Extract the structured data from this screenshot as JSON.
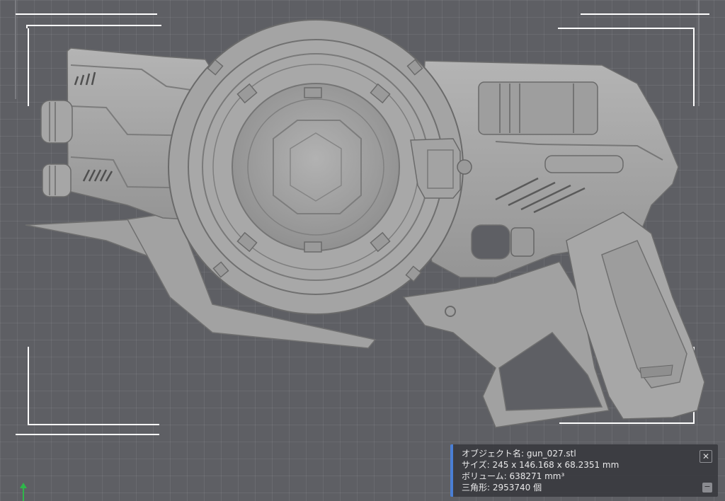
{
  "viewport": {
    "background_color": "#5e5f64",
    "grid_color": "#6a6b70",
    "model_color": "#a8a8a8",
    "frame_color": "#ffffff",
    "axis_color": "#2fb74a"
  },
  "info_panel": {
    "accent_color": "#4a7fd6",
    "object_name": "オブジェクト名: gun_027.stl",
    "size": "サイズ: 245 x 146.168 x 68.2351 mm",
    "volume": "ボリューム: 638271 mm³",
    "triangles": "三角形: 2953740 個",
    "close_icon": "close-icon",
    "close_glyph": "✕",
    "minimize_icon": "minimize-icon",
    "minimize_glyph": "−"
  }
}
